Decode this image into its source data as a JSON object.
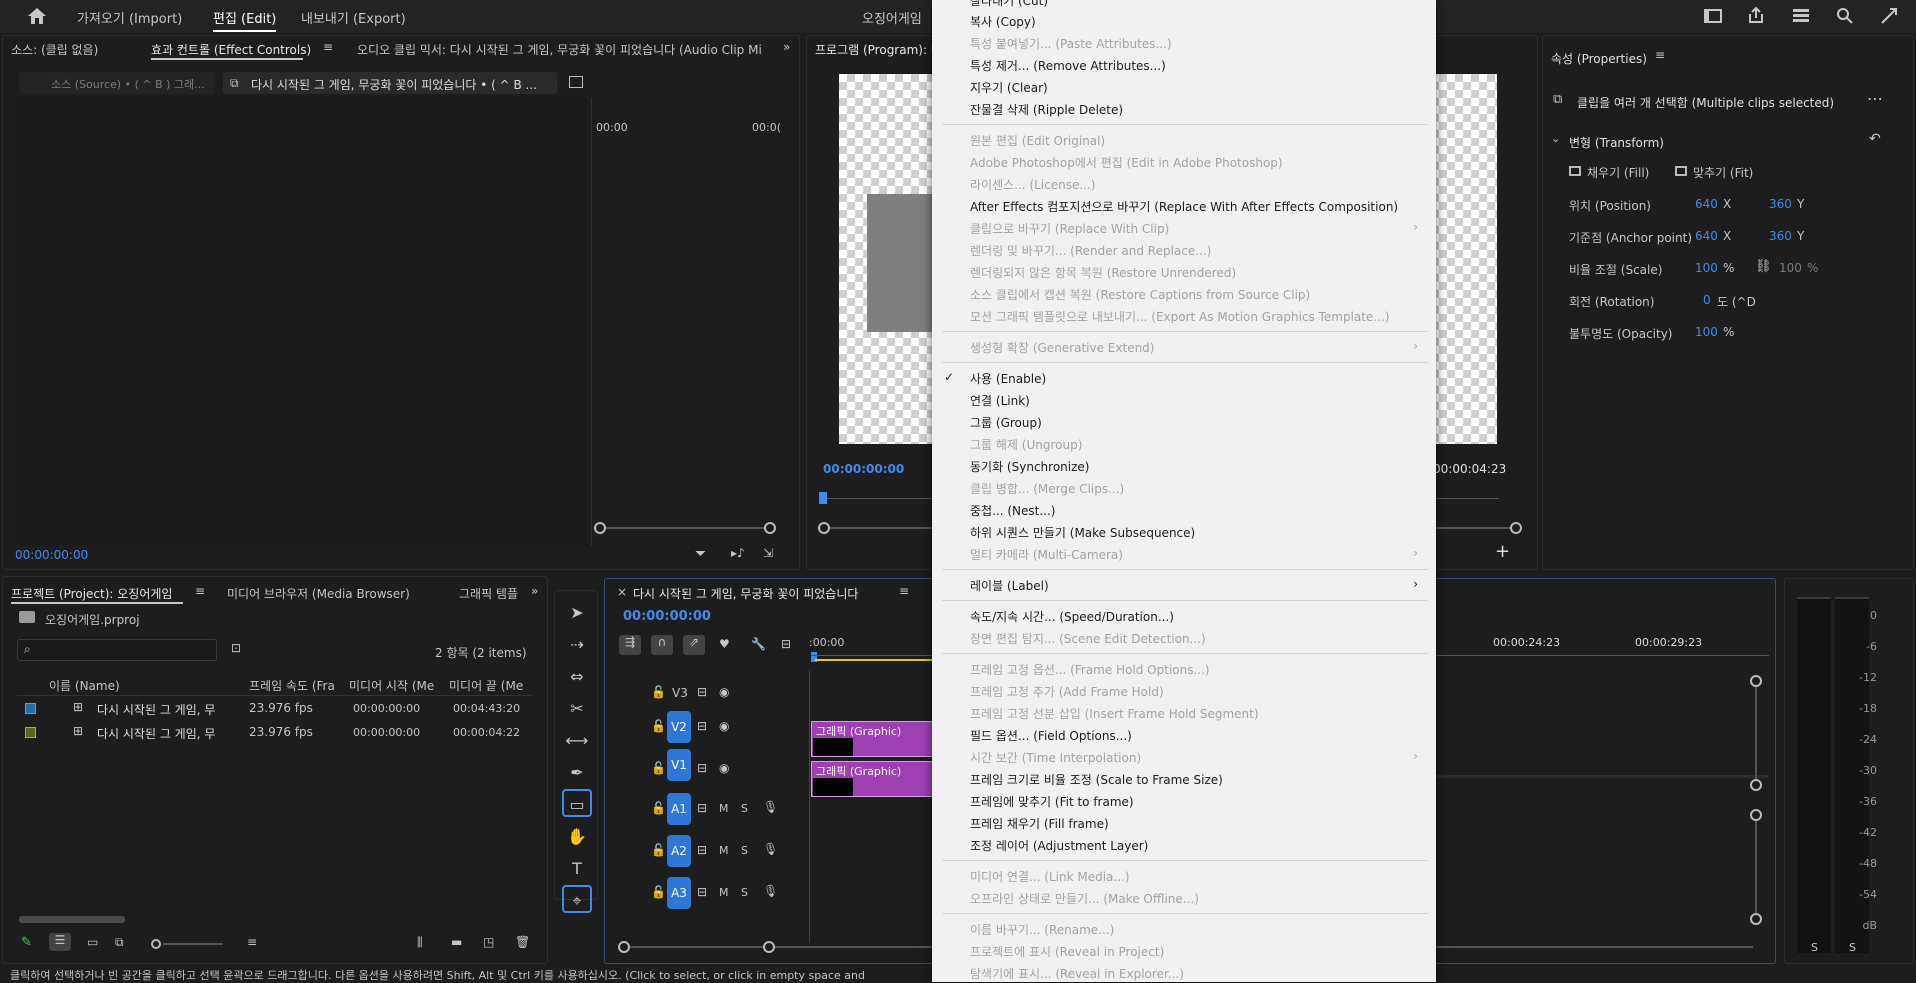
{
  "app": {
    "home_icon": "home-icon",
    "workspace_tabs": [
      "가져오기 (Import)",
      "편집 (Edit)",
      "내보내기 (Export)"
    ],
    "title": "오징어게임"
  },
  "source_panel": {
    "tabs": [
      "소스: (클립 없음)",
      "효과 컨트롤 (Effect Controls)",
      "오디오 클립 믹서: 다시 시작된 그 게임, 무궁화 꽃이 피었습니다  (Audio Clip Mi"
    ],
    "source_dropdown": "소스 (Source) • ( ^ B ) 그래...",
    "clip_dropdown": "다시 시작된 그 게임, 무궁화 꽃이 피었습니다  •  ( ^ B ...",
    "ruler_start": "00:00",
    "ruler_end": "00:0(",
    "timecode": "00:00:00:00"
  },
  "program_panel": {
    "tab": "프로그램 (Program): 다",
    "timecode_left": "00:00:00:00",
    "timecode_right": "00:00:04:23"
  },
  "properties_panel": {
    "title": "속성 (Properties)",
    "selection": "클립을 여러 개 선택함 (Multiple clips selected)",
    "section": "변형 (Transform)",
    "fill_label": "채우기 (Fill)",
    "fit_label": "맞추기 (Fit)",
    "rows": [
      {
        "label": "위치 (Position)",
        "v1": "640",
        "u1": "X",
        "v2": "360",
        "u2": "Y"
      },
      {
        "label": "기준점 (Anchor point)",
        "v1": "640",
        "u1": "X",
        "v2": "360",
        "u2": "Y"
      },
      {
        "label": "비율 조절 (Scale)",
        "v1": "100",
        "u1": "%",
        "v2": "100",
        "u2": "%"
      },
      {
        "label": "회전 (Rotation)",
        "v1": "0",
        "u1": "도 (^D",
        "v2": "",
        "u2": ""
      },
      {
        "label": "불투명도 (Opacity)",
        "v1": "100",
        "u1": "%",
        "v2": "",
        "u2": ""
      }
    ]
  },
  "project_panel": {
    "tabs": [
      "프로젝트 (Project): 오징어게임",
      "미디어 브라우저 (Media Browser)",
      "그래픽 템플"
    ],
    "file": "오징어게임.prproj",
    "search_placeholder": "",
    "item_count": "2 항목 (2 items)",
    "columns": [
      "이름 (Name)",
      "프레임 속도 (Fra",
      "미디어 시작 (Me",
      "미디어 끝 (Me"
    ],
    "items": [
      {
        "name": "다시 시작된 그 게임, 무",
        "fps": "23.976 fps",
        "start": "00:00:00:00",
        "end": "00:04:43:20",
        "color": "#1f6fa8"
      },
      {
        "name": "다시 시작된 그 게임, 무",
        "fps": "23.976 fps",
        "start": "00:00:00:00",
        "end": "00:00:04:22",
        "color": "#7f8a1c"
      }
    ]
  },
  "timeline": {
    "sequence_name": "다시 시작된 그 게임, 무궁화 꽃이 피었습니다",
    "timecode": "00:00:00:00",
    "ruler": [
      ":00:00",
      "00:00:24:23",
      "00:00:29:23"
    ],
    "tracks": [
      "V3",
      "V2",
      "V1",
      "A1",
      "A2",
      "A3"
    ],
    "mute_label": "M",
    "solo_label": "S",
    "clip_label": "그래픽 (Graphic)"
  },
  "meter": {
    "labels": [
      "0",
      "-6",
      "-12",
      "-18",
      "-24",
      "-30",
      "-36",
      "-42",
      "-48",
      "-54",
      "dB"
    ],
    "channels": [
      "S",
      "S"
    ]
  },
  "status_bar": "클릭하여 선택하거나 빈 공간을 클릭하고 선택 윤곽으로 드래그합니다. 다른 옵션을 사용하려면 Shift, Alt 및 Ctrl 키를 사용하십시오. (Click to select, or click in empty space and",
  "context_menu": [
    {
      "label": "잘라내기 (Cut)",
      "enabled": true
    },
    {
      "label": "복사 (Copy)",
      "enabled": true
    },
    {
      "label": "특성 붙여넣기... (Paste Attributes...)",
      "enabled": false
    },
    {
      "label": "특성 제거... (Remove Attributes...)",
      "enabled": true
    },
    {
      "label": "지우기 (Clear)",
      "enabled": true
    },
    {
      "label": "잔물결 삭제 (Ripple Delete)",
      "enabled": true
    },
    {
      "label": "원본 편집 (Edit Original)",
      "enabled": false
    },
    {
      "label": "Adobe Photoshop에서 편집 (Edit in Adobe Photoshop)",
      "enabled": false
    },
    {
      "label": "라이센스... (License...)",
      "enabled": false
    },
    {
      "label": "After Effects 컴포지션으로 바꾸기 (Replace With After Effects Composition)",
      "enabled": true
    },
    {
      "label": "클립으로 바꾸기 (Replace With Clip)",
      "enabled": false,
      "submenu": true
    },
    {
      "label": "렌더링 및 바꾸기... (Render and Replace...)",
      "enabled": false
    },
    {
      "label": "렌더링되지 않은 항목 복원 (Restore Unrendered)",
      "enabled": false
    },
    {
      "label": "소스 클립에서 캡션 복원 (Restore Captions from Source Clip)",
      "enabled": false
    },
    {
      "label": "모션 그래픽 템플릿으로 내보내기... (Export As Motion Graphics Template...)",
      "enabled": false
    },
    {
      "label": "생성형 확장 (Generative Extend)",
      "enabled": false,
      "submenu": true
    },
    {
      "label": "사용 (Enable)",
      "enabled": true,
      "checked": true
    },
    {
      "label": "연결 (Link)",
      "enabled": true
    },
    {
      "label": "그룹 (Group)",
      "enabled": true
    },
    {
      "label": "그룹 해제 (Ungroup)",
      "enabled": false
    },
    {
      "label": "동기화 (Synchronize)",
      "enabled": true
    },
    {
      "label": "클립 병합... (Merge Clips...)",
      "enabled": false
    },
    {
      "label": "중첩... (Nest...)",
      "enabled": true
    },
    {
      "label": "하위 시퀀스 만들기 (Make Subsequence)",
      "enabled": true
    },
    {
      "label": "멀티 카메라 (Multi-Camera)",
      "enabled": false,
      "submenu": true
    },
    {
      "label": "레이블 (Label)",
      "enabled": true,
      "submenu": true
    },
    {
      "label": "속도/지속 시간... (Speed/Duration...)",
      "enabled": true
    },
    {
      "label": "장면 편집 탐지... (Scene Edit Detection...)",
      "enabled": false
    },
    {
      "label": "프레임 고정 옵션... (Frame Hold Options...)",
      "enabled": false
    },
    {
      "label": "프레임 고정 추가 (Add Frame Hold)",
      "enabled": false
    },
    {
      "label": "프레임 고정 선분 삽입 (Insert Frame Hold Segment)",
      "enabled": false
    },
    {
      "label": "필드 옵션... (Field Options...)",
      "enabled": true
    },
    {
      "label": "시간 보간 (Time Interpolation)",
      "enabled": false,
      "submenu": true
    },
    {
      "label": "프레임 크기로 비율 조정 (Scale to Frame Size)",
      "enabled": true
    },
    {
      "label": "프레임에 맞추기 (Fit to frame)",
      "enabled": true
    },
    {
      "label": "프레임 채우기 (Fill frame)",
      "enabled": true
    },
    {
      "label": "조정 레이어 (Adjustment Layer)",
      "enabled": true
    },
    {
      "label": "미디어 연결... (Link Media...)",
      "enabled": false
    },
    {
      "label": "오프라인 상태로 만들기... (Make Offline...)",
      "enabled": false
    },
    {
      "label": "이름 바꾸기... (Rename...)",
      "enabled": false
    },
    {
      "label": "프로젝트에 표시 (Reveal in Project)",
      "enabled": false
    },
    {
      "label": "탐색기에 표시... (Reveal in Explorer...)",
      "enabled": false
    }
  ],
  "colors": {
    "accent": "#3f8bf0",
    "clip": "#9e3fb4",
    "track_badge": "#2e76d8"
  }
}
